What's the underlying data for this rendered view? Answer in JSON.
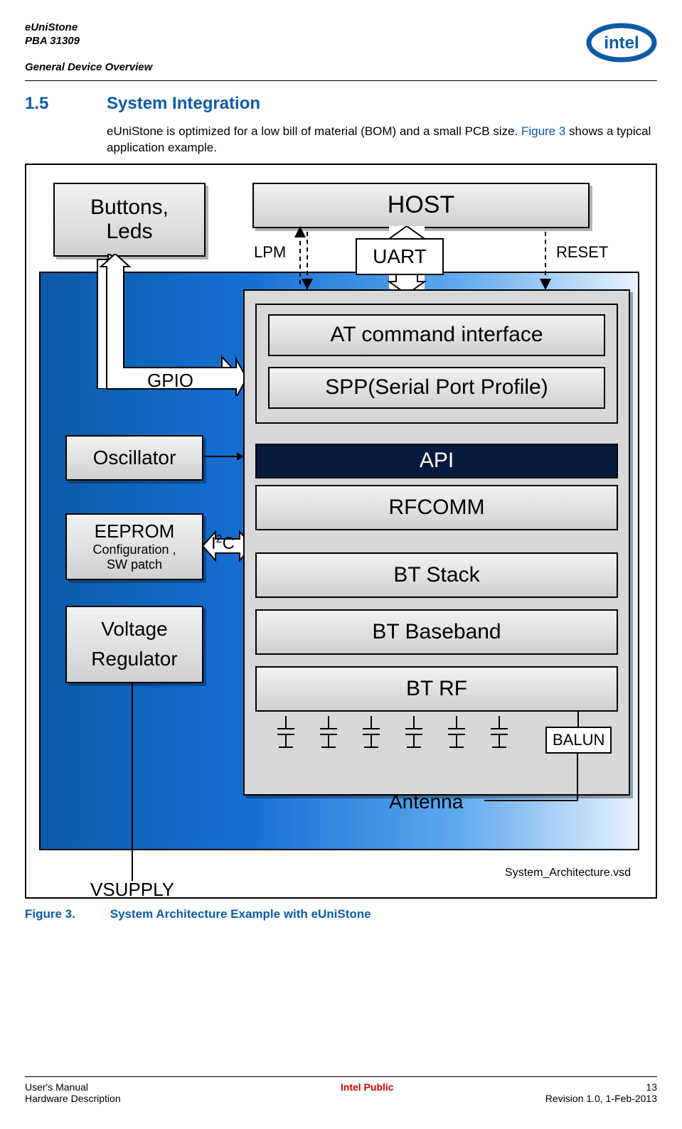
{
  "header": {
    "product": "eUniStone",
    "pba": "PBA 31309",
    "section_group": "General Device Overview"
  },
  "section": {
    "number": "1.5",
    "title": "System Integration",
    "paragraph_pre": "eUniStone is optimized for a low bill of material (BOM) and a small PCB size. ",
    "figure_ref": "Figure 3",
    "paragraph_post": " shows a typical application example."
  },
  "figure": {
    "buttons_leds": "Buttons,\nLeds",
    "host": "HOST",
    "uart": "UART",
    "lpm": "LPM",
    "reset": "RESET",
    "gpio": "GPIO",
    "oscillator": "Oscillator",
    "eeprom_title": "EEPROM",
    "eeprom_sub": "Configuration ,\nSW patch",
    "i2c": "I2C",
    "voltage_reg": "Voltage\nRegulator",
    "vsupply": "VSUPPLY",
    "at_cmd": "AT  command  interface",
    "spp": "SPP(Serial  Port Profile)",
    "api": "API",
    "rfcomm": "RFCOMM",
    "bt_stack": "BT Stack",
    "bt_baseband": "BT Baseband",
    "bt_rf": "BT RF",
    "balun": "BALUN",
    "antenna": "Antenna",
    "source_file": "System_Architecture.vsd"
  },
  "caption": {
    "label": "Figure 3.",
    "text": "System Architecture Example with eUniStone"
  },
  "footer": {
    "left1": "User's Manual",
    "left2": "Hardware Description",
    "center": "Intel Public",
    "right1": "13",
    "right2": "Revision 1.0, 1-Feb-2013"
  }
}
